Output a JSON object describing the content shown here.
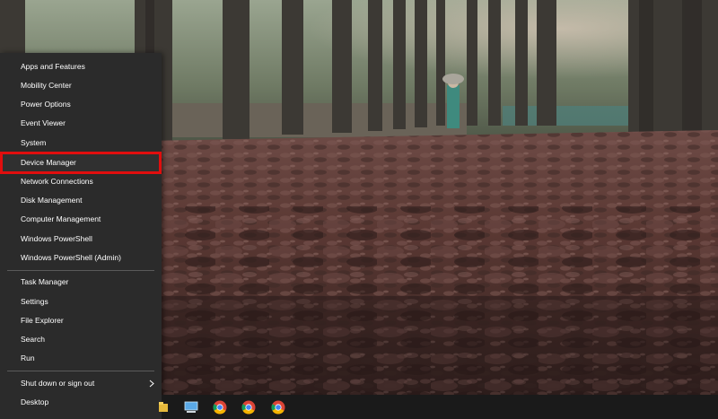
{
  "menu": {
    "group1": [
      {
        "label": "Apps and Features"
      },
      {
        "label": "Mobility Center"
      },
      {
        "label": "Power Options"
      },
      {
        "label": "Event Viewer"
      },
      {
        "label": "System"
      },
      {
        "label": "Device Manager",
        "highlighted": true
      },
      {
        "label": "Network Connections"
      },
      {
        "label": "Disk Management"
      },
      {
        "label": "Computer Management"
      },
      {
        "label": "Windows PowerShell"
      },
      {
        "label": "Windows PowerShell (Admin)"
      }
    ],
    "group2": [
      {
        "label": "Task Manager"
      },
      {
        "label": "Settings"
      },
      {
        "label": "File Explorer"
      },
      {
        "label": "Search"
      },
      {
        "label": "Run"
      }
    ],
    "group3": [
      {
        "label": "Shut down or sign out",
        "has_submenu": true
      },
      {
        "label": "Desktop"
      }
    ],
    "highlight_color": "#e10e0e",
    "background_color": "#2b2b2b"
  },
  "taskbar": {
    "background_color": "#1a1a1a",
    "apps": [
      {
        "icon": "file-explorer-icon"
      },
      {
        "icon": "this-pc-icon"
      },
      {
        "icon": "chrome-icon"
      },
      {
        "icon": "chrome-icon"
      },
      {
        "icon": "chrome-icon"
      }
    ]
  }
}
